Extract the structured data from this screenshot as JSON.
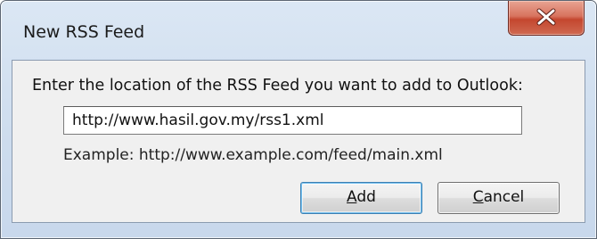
{
  "dialog": {
    "title": "New RSS Feed",
    "close_symbol": "X"
  },
  "form": {
    "prompt": "Enter the location of the RSS Feed you want to add to Outlook:",
    "url_value": "http://www.hasil.gov.my/rss1.xml",
    "example": "Example: http://www.example.com/feed/main.xml"
  },
  "buttons": {
    "add": {
      "mnemonic": "A",
      "rest": "dd"
    },
    "cancel": {
      "mnemonic": "C",
      "rest": "ancel"
    }
  },
  "icons": {
    "close": "close-icon"
  },
  "colors": {
    "close_button": "#c4462e",
    "default_button_border": "#3c7fb1"
  }
}
